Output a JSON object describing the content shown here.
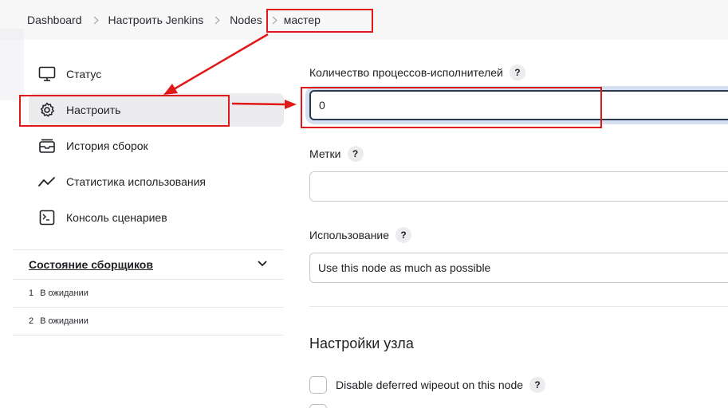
{
  "breadcrumb": {
    "items": [
      "Dashboard",
      "Настроить Jenkins",
      "Nodes",
      "мастер"
    ]
  },
  "sidebar": {
    "tasks": [
      {
        "label": "Статус",
        "icon": "monitor-icon"
      },
      {
        "label": "Настроить",
        "icon": "gear-icon"
      },
      {
        "label": "История сборок",
        "icon": "build-history-icon"
      },
      {
        "label": "Статистика использования",
        "icon": "trend-icon"
      },
      {
        "label": "Консоль сценариев",
        "icon": "terminal-icon"
      }
    ],
    "active_index": 1,
    "executors": {
      "title": "Состояние сборщиков",
      "rows": [
        {
          "num": "1",
          "status": "В ожидании"
        },
        {
          "num": "2",
          "status": "В ожидании"
        }
      ]
    }
  },
  "form": {
    "executors_label": "Количество процессов-исполнителей",
    "executors_value": "0",
    "labels_label": "Метки",
    "labels_value": "",
    "usage_label": "Использование",
    "usage_value": "Use this node as much as possible",
    "help_glyph": "?",
    "section_title": "Настройки узла",
    "checkbox_label": "Disable deferred wipeout on this node"
  },
  "annotation_color": "#e01818"
}
